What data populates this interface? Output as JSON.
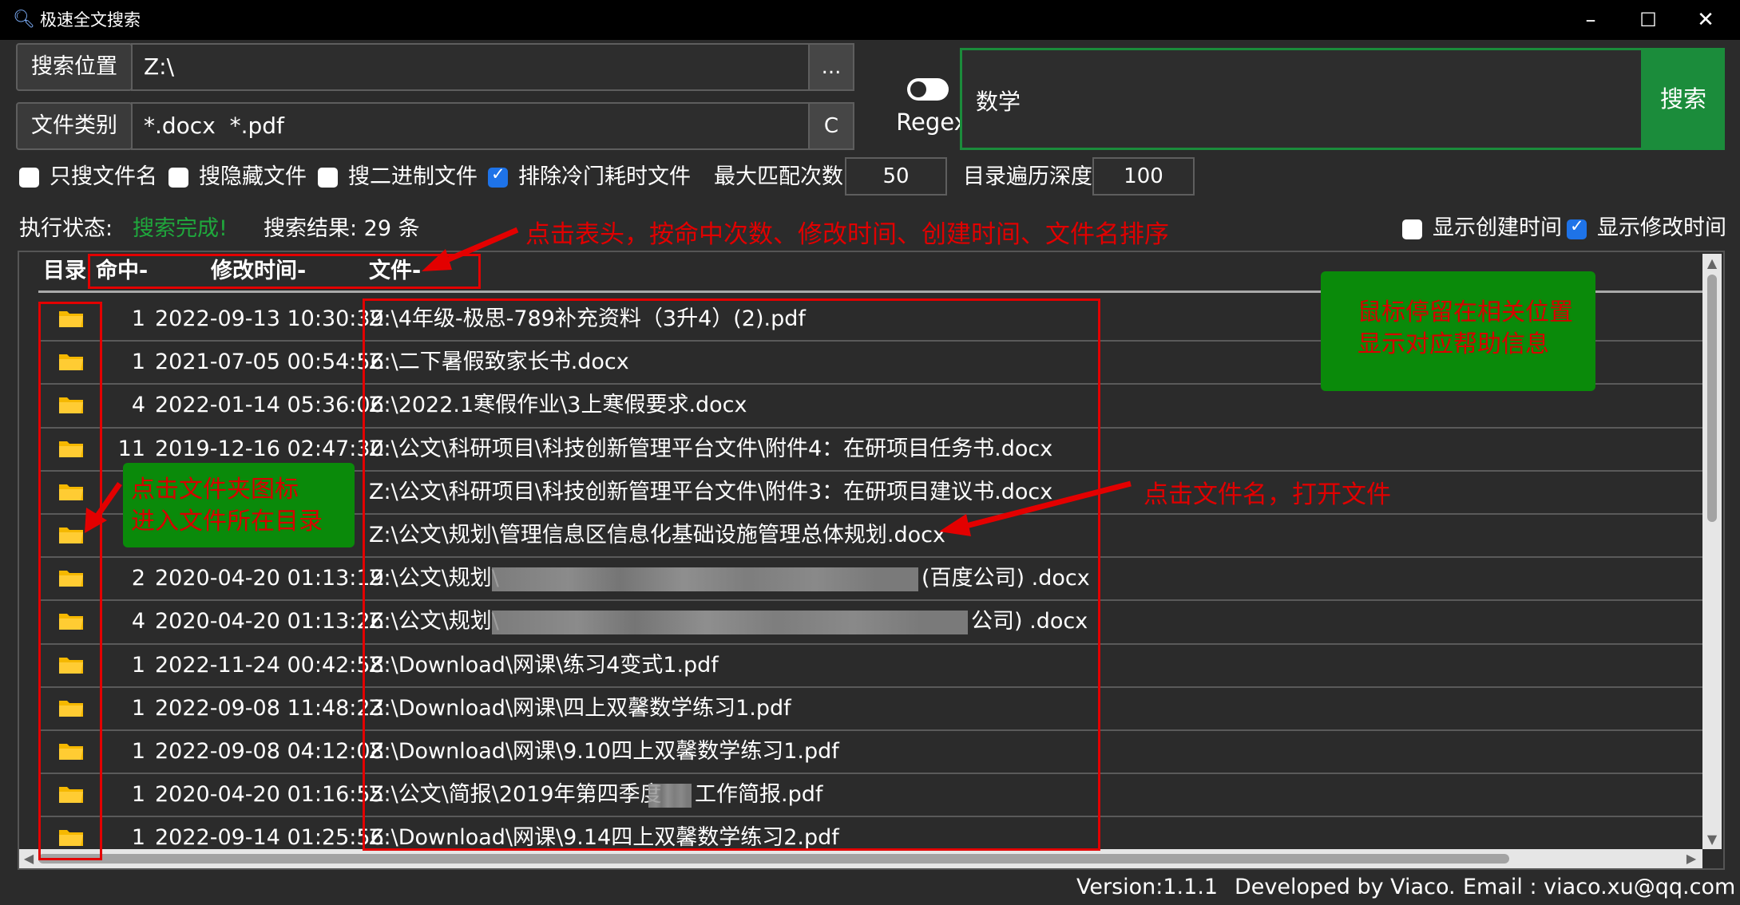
{
  "window": {
    "title": "极速全文搜索",
    "minimize": "–",
    "maximize": "☐",
    "close": "✕"
  },
  "search": {
    "location_label": "搜索位置",
    "location_value": "Z:\\",
    "browse_label": "...",
    "type_label": "文件类别",
    "type_value": "*.docx  *.pdf",
    "clear_label": "C",
    "regex_label": "Regex",
    "keyword": "数学",
    "search_button": "搜索"
  },
  "options": {
    "only_filename": {
      "label": "只搜文件名",
      "checked": false
    },
    "hidden_files": {
      "label": "搜隐藏文件",
      "checked": false
    },
    "binary_files": {
      "label": "搜二进制文件",
      "checked": false
    },
    "exclude_slow": {
      "label": "排除冷门耗时文件",
      "checked": true
    },
    "max_match_label": "最大匹配次数",
    "max_match_value": "50",
    "depth_label": "目录遍历深度",
    "depth_value": "100"
  },
  "status": {
    "exec_label": "执行状态:",
    "exec_value": "搜索完成!",
    "result_label": "搜索结果: 29 条",
    "show_created": {
      "label": "显示创建时间",
      "checked": false
    },
    "show_modified": {
      "label": "显示修改时间",
      "checked": true
    }
  },
  "table": {
    "headers": {
      "dir": "目录",
      "hits": "命中-",
      "modified": "修改时间-",
      "file": "文件-"
    },
    "rows": [
      {
        "hits": "1",
        "modified": "2022-09-13 10:30:39",
        "file": "Z:\\4年级-极思-789补充资料（3升4）(2).pdf"
      },
      {
        "hits": "1",
        "modified": "2021-07-05 00:54:56",
        "file": "Z:\\二下暑假致家长书.docx"
      },
      {
        "hits": "4",
        "modified": "2022-01-14 05:36:06",
        "file": "Z:\\2022.1寒假作业\\3上寒假要求.docx"
      },
      {
        "hits": "11",
        "modified": "2019-12-16 02:47:30",
        "file": "Z:\\公文\\科研项目\\科技创新管理平台文件\\附件4：在研项目任务书.docx"
      },
      {
        "hits": "",
        "modified": "",
        "file": "Z:\\公文\\科研项目\\科技创新管理平台文件\\附件3：在研项目建议书.docx"
      },
      {
        "hits": "",
        "modified": "",
        "file": "Z:\\公文\\规划\\管理信息区信息化基础设施管理总体规划.docx"
      },
      {
        "hits": "2",
        "modified": "2020-04-20 01:13:19",
        "file": "Z:\\公文\\规划\\",
        "file_tail": "(百度公司) .docx"
      },
      {
        "hits": "4",
        "modified": "2020-04-20 01:13:26",
        "file": "Z:\\公文\\规划\\",
        "file_tail": "公司) .docx"
      },
      {
        "hits": "1",
        "modified": "2022-11-24 00:42:58",
        "file": "Z:\\Download\\网课\\练习4变式1.pdf"
      },
      {
        "hits": "1",
        "modified": "2022-09-08 11:48:23",
        "file": "Z:\\Download\\网课\\四上双馨数学练习1.pdf"
      },
      {
        "hits": "1",
        "modified": "2022-09-08 04:12:08",
        "file": "Z:\\Download\\网课\\9.10四上双馨数学练习1.pdf"
      },
      {
        "hits": "1",
        "modified": "2020-04-20 01:16:55",
        "file": "Z:\\公文\\简报\\2019年第四季度",
        "file_tail": "工作简报.pdf"
      },
      {
        "hits": "1",
        "modified": "2022-09-14 01:25:56",
        "file": "Z:\\Download\\网课\\9.14四上双馨数学练习2.pdf"
      }
    ]
  },
  "annotations": {
    "sort_hint": "点击表头，按命中次数、修改时间、创建时间、文件名排序",
    "hover_hint_line1": "鼠标停留在相关位置",
    "hover_hint_line2": "显示对应帮助信息",
    "folder_hint_line1": "点击文件夹图标",
    "folder_hint_line2": "进入文件所在目录",
    "open_hint": "点击文件名，打开文件"
  },
  "footer": {
    "version": "Version:1.1.1",
    "developer": "Developed by Viaco.",
    "email": "Email : viaco.xu@qq.com"
  },
  "colors": {
    "accent_green": "#1b8c3b",
    "status_green": "#1fa83c",
    "annotation_red": "#e00000",
    "checkbox_blue": "#1e73e8",
    "folder_yellow": "#f5b800"
  }
}
